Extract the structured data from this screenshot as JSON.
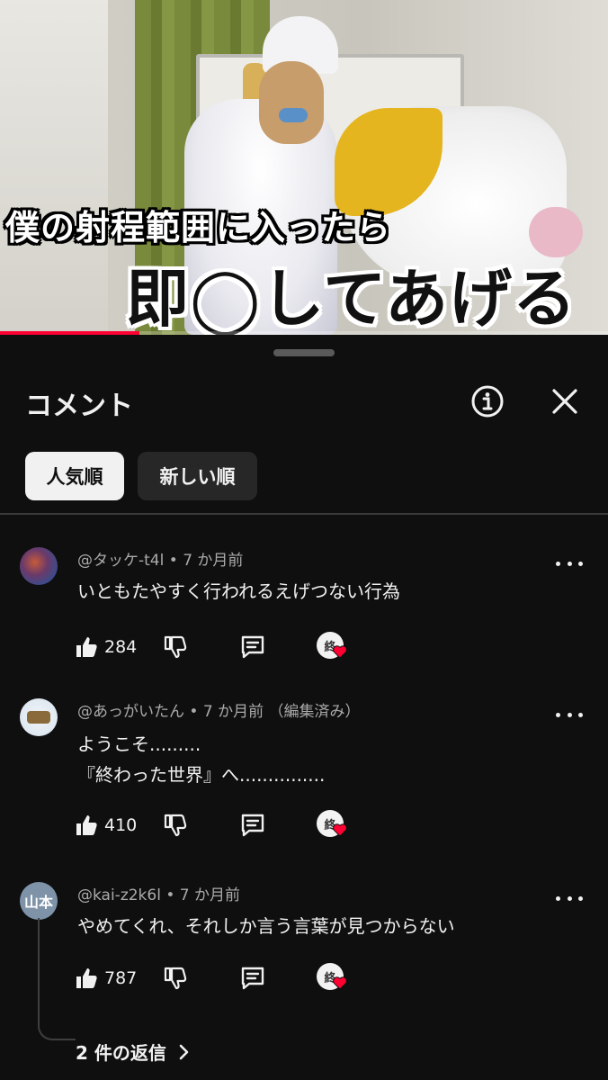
{
  "video": {
    "overlay_line1": "僕の射程範囲に入ったら",
    "overlay_line2": "即◯してあげる",
    "progress_fraction": 0.23
  },
  "sheet": {
    "title": "コメント",
    "info_icon": "info-circle-icon",
    "close_icon": "close-icon",
    "sort_chips": [
      {
        "label": "人気順",
        "selected": true
      },
      {
        "label": "新しい順",
        "selected": false
      }
    ]
  },
  "comments": [
    {
      "author": "@タッケ-t4l",
      "time": "7 か月前",
      "edited": "",
      "lines": "いともたやすく行われるえげつない行為",
      "likes": "284",
      "creator_heart_badge": "終"
    },
    {
      "author": "@あっがいたん",
      "time": "7 か月前",
      "edited": "（編集済み）",
      "lines": "ようこそ.........\n『終わった世界』へ...............",
      "likes": "410",
      "creator_heart_badge": "終"
    },
    {
      "author": "@kai-z2k6l",
      "time": "7 か月前",
      "edited": "",
      "lines": "やめてくれ、それしか言う言葉が見つからない",
      "likes": "787",
      "creator_heart_badge": "終",
      "avatar_text": "山本",
      "replies_label": "2 件の返信"
    }
  ],
  "colors": {
    "background": "#0f0f0f",
    "text": "#f1f1f1",
    "muted": "#aaaaaa",
    "accent_red": "#ff0033",
    "heart": "#ff0033"
  }
}
